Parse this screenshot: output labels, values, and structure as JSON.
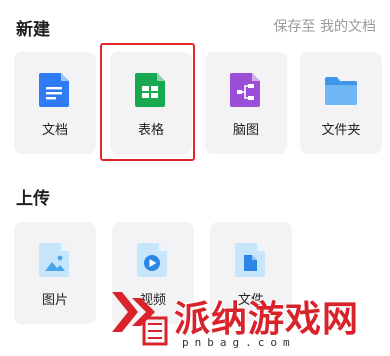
{
  "new_section": {
    "title": "新建",
    "save_to": "保存至 我的文档",
    "items": [
      {
        "label": "文档",
        "icon": "doc-icon",
        "color": "#2f7bf5"
      },
      {
        "label": "表格",
        "icon": "sheet-icon",
        "color": "#16a94f"
      },
      {
        "label": "脑图",
        "icon": "mindmap-icon",
        "color": "#9a4fd6"
      },
      {
        "label": "文件夹",
        "icon": "folder-icon",
        "color": "#5aa9f0"
      }
    ]
  },
  "upload_section": {
    "title": "上传",
    "items": [
      {
        "label": "图片",
        "icon": "image-file-icon"
      },
      {
        "label": "视频",
        "icon": "video-file-icon"
      },
      {
        "label": "文件",
        "icon": "file-icon"
      }
    ]
  },
  "highlight_color": "#e0262b",
  "watermark": {
    "text": "派纳游戏网",
    "url": "pnbag.com"
  }
}
